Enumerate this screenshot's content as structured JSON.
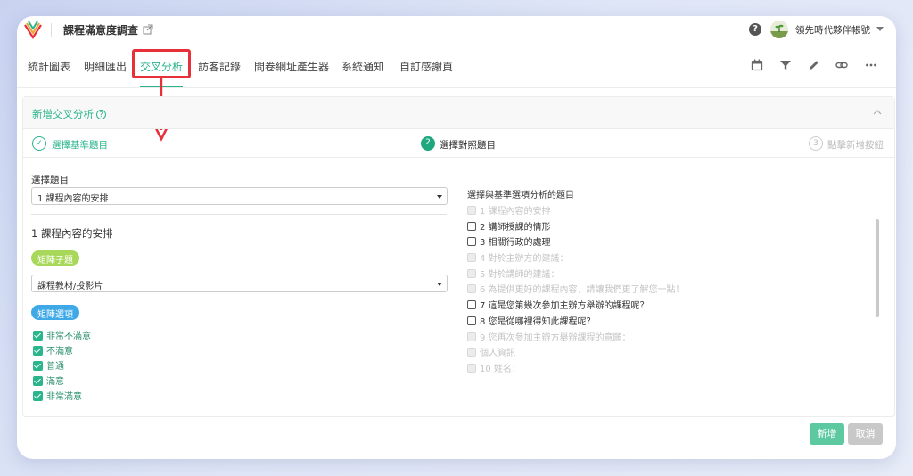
{
  "header": {
    "title": "課程滿意度調查",
    "help": "?",
    "account": "領先時代夥伴帳號"
  },
  "tabs": [
    {
      "label": "統計圖表"
    },
    {
      "label": "明細匯出"
    },
    {
      "label": "交叉分析",
      "active": true
    },
    {
      "label": "訪客記錄"
    },
    {
      "label": "問卷網址產生器"
    },
    {
      "label": "系統通知"
    },
    {
      "label": "自訂感謝頁"
    }
  ],
  "toolbar_icons": [
    "calendar-icon",
    "filter-icon",
    "pencil-icon",
    "link-icon",
    "more-icon"
  ],
  "panel": {
    "title": "新增交叉分析",
    "help": "?"
  },
  "steps": [
    {
      "number": "1",
      "label": "選擇基準題目",
      "status": "done"
    },
    {
      "number": "2",
      "label": "選擇對照題目",
      "status": "current"
    },
    {
      "number": "3",
      "label": "點擊新增按鈕",
      "status": "pending"
    }
  ],
  "left": {
    "select_label": "選擇題目",
    "select_value": "1 課程內容的安排",
    "question_heading": "1 課程內容的安排",
    "matrix_sub_pill": "矩陣子題",
    "matrix_sub_value": "課程教材/投影片",
    "matrix_option_pill": "矩陣選項",
    "options": [
      "非常不滿意",
      "不滿意",
      "普通",
      "滿意",
      "非常滿意"
    ]
  },
  "right": {
    "title": "選擇與基準選項分析的題目",
    "questions": [
      {
        "label": "1 課程內容的安排",
        "enabled": false
      },
      {
        "label": "2 講師授課的情形",
        "enabled": true
      },
      {
        "label": "3 相關行政的處理",
        "enabled": true
      },
      {
        "label": "4 對於主辦方的建議：",
        "enabled": false
      },
      {
        "label": "5 對於講師的建議：",
        "enabled": false
      },
      {
        "label": "6 為提供更好的課程內容，請讓我們更了解您一點！",
        "enabled": false
      },
      {
        "label": "7 這是您第幾次參加主辦方舉辦的課程呢？",
        "enabled": true
      },
      {
        "label": "8 您是從哪裡得知此課程呢？",
        "enabled": true
      },
      {
        "label": "9 您再次參加主辦方舉辦課程的意願：",
        "enabled": false
      },
      {
        "label": "個人資訊",
        "enabled": false
      },
      {
        "label": "10 姓名：",
        "enabled": false
      }
    ]
  },
  "footer": {
    "add_label": "新增",
    "cancel_label": "取消"
  },
  "colors": {
    "accent": "#2bb58c",
    "highlight": "#e8303a",
    "step2": "#1fa77f",
    "add_button": "#5cc9a1",
    "cancel_button": "#c8c8c8"
  }
}
